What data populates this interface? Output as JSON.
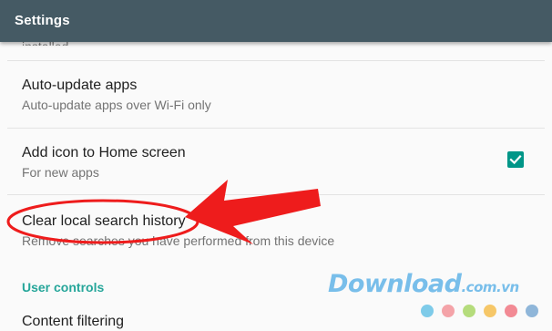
{
  "appbar": {
    "title": "Settings"
  },
  "peek_text": "Notify me about updates to apps I installed",
  "settings": {
    "auto_update": {
      "title": "Auto-update apps",
      "subtitle": "Auto-update apps over Wi-Fi only"
    },
    "add_icon": {
      "title": "Add icon to Home screen",
      "subtitle": "For new apps",
      "checked": true
    },
    "clear_history": {
      "title": "Clear local search history",
      "subtitle": "Remove searches you have performed from this device"
    }
  },
  "section_user_controls": "User controls",
  "content_filtering": {
    "title": "Content filtering"
  },
  "annotation": {
    "color": "#ee1c1c"
  },
  "watermark": {
    "brand": "Download",
    "ext": ".com.vn",
    "dot_colors": [
      "#7ecbe9",
      "#f4a3a8",
      "#b5dc7c",
      "#f6c768",
      "#f28a94",
      "#8fb6d9"
    ]
  },
  "colors": {
    "appbar": "#455a64",
    "accent": "#009688",
    "section": "#26a69a"
  }
}
